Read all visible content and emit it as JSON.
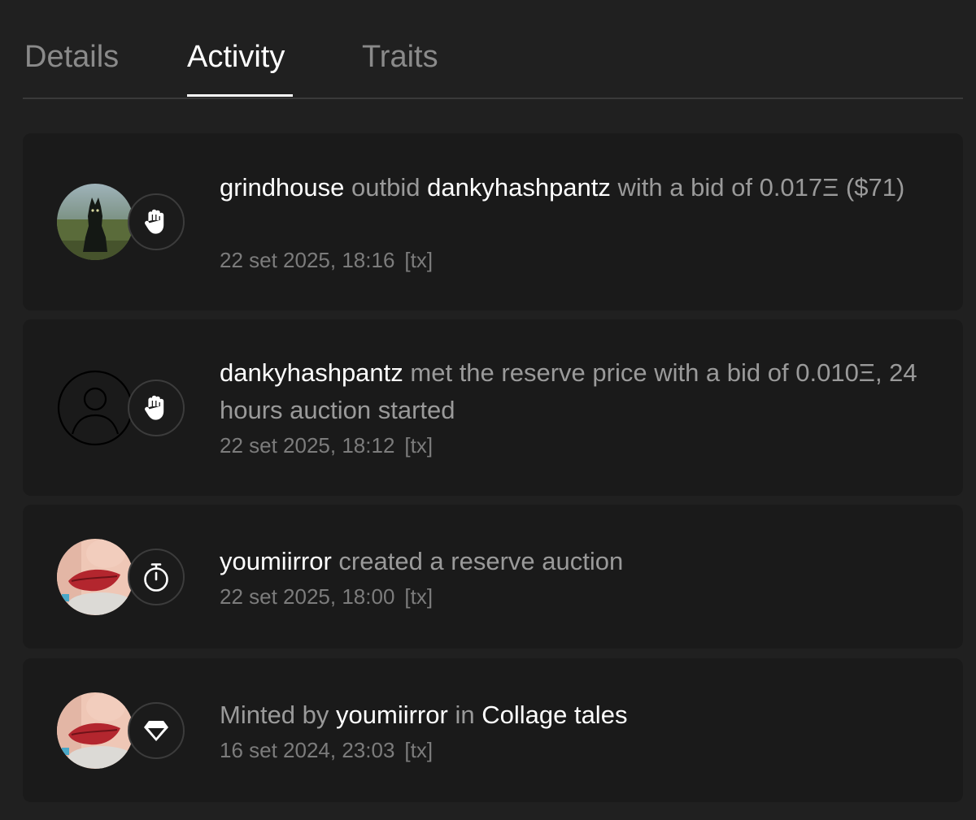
{
  "tabs": [
    {
      "label": "Details"
    },
    {
      "label": "Activity",
      "active": true
    },
    {
      "label": "Traits"
    }
  ],
  "activity": [
    {
      "user": "grindhouse",
      "verb": "outbid",
      "target": "dankyhashpantz",
      "rest": "with a bid of 0.017Ξ ($71)",
      "date": "22 set 2025, 18:16",
      "tx": "[tx]",
      "icon": "hand-icon"
    },
    {
      "user": "dankyhashpantz",
      "rest": "met the reserve price with a bid of 0.010Ξ, 24 hours auction started",
      "date": "22 set 2025, 18:12",
      "tx": "[tx]",
      "icon": "hand-icon"
    },
    {
      "user": "youmiirror",
      "rest": "created a reserve auction",
      "date": "22 set 2025, 18:00",
      "tx": "[tx]",
      "icon": "stopwatch-icon"
    },
    {
      "prefix": "Minted by",
      "user": "youmiirror",
      "mid": "in",
      "collection": "Collage tales",
      "date": "16 set 2024, 23:03",
      "tx": "[tx]",
      "icon": "diamond-icon"
    }
  ],
  "colors": {
    "background": "#202020",
    "card": "#1a1a1a",
    "text_primary": "#ffffff",
    "text_secondary": "#9a9a9a"
  }
}
